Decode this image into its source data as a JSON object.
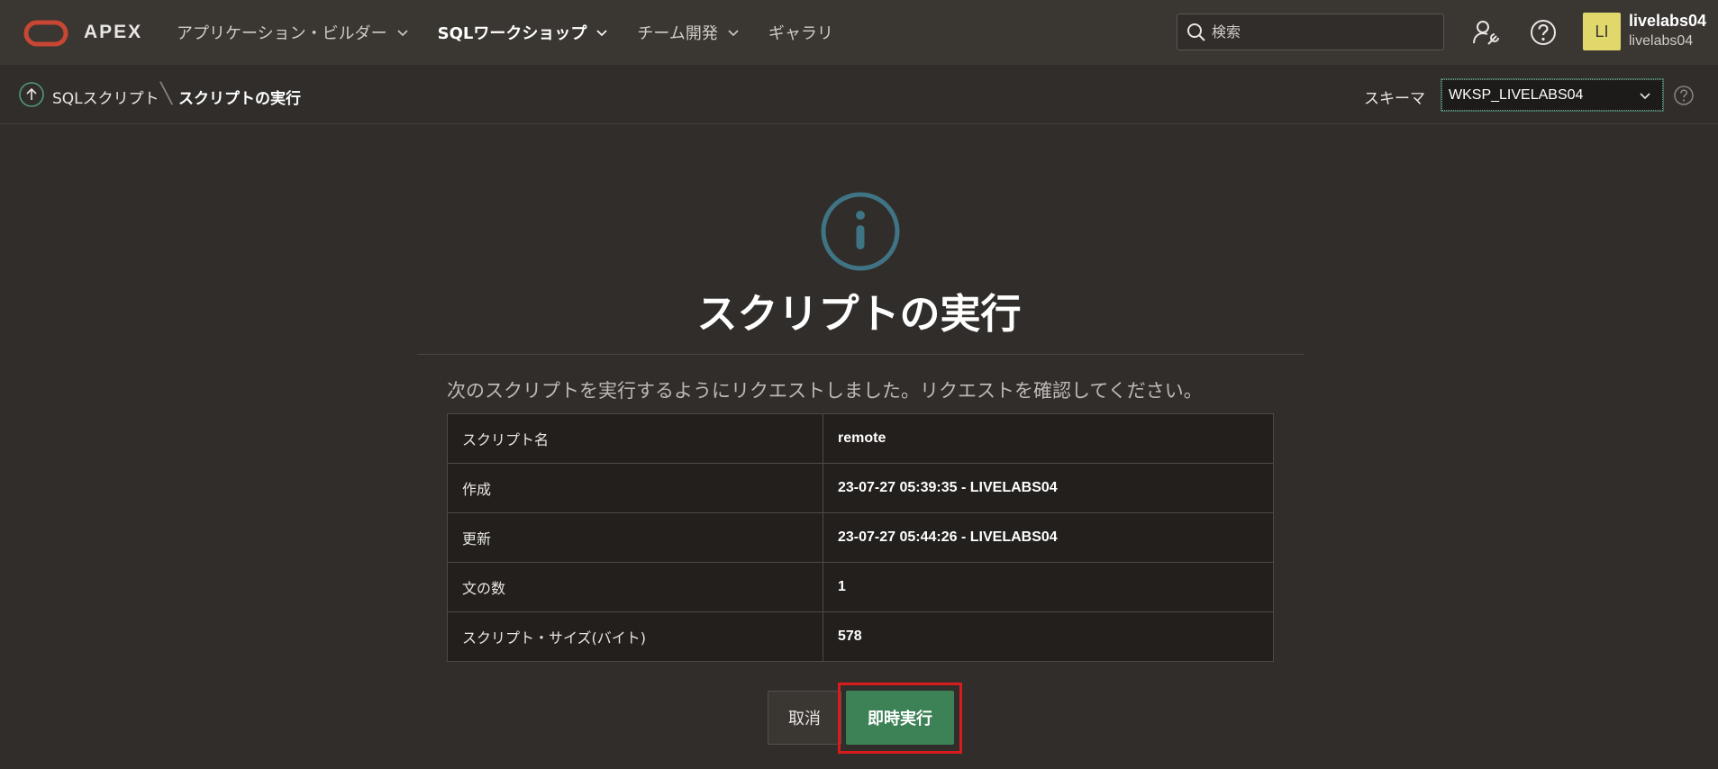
{
  "header": {
    "brand": "APEX",
    "nav": [
      {
        "label": "アプリケーション・ビルダー",
        "active": false
      },
      {
        "label": "SQLワークショップ",
        "active": true
      },
      {
        "label": "チーム開発",
        "active": false
      },
      {
        "label": "ギャラリ",
        "active": false
      }
    ],
    "search_placeholder": "検索",
    "user": {
      "initials": "LI",
      "name": "livelabs04",
      "workspace": "livelabs04"
    }
  },
  "breadcrumb": {
    "parent": "SQLスクリプト",
    "current": "スクリプトの実行"
  },
  "schema": {
    "label": "スキーマ",
    "value": "WKSP_LIVELABS04"
  },
  "main": {
    "title": "スクリプトの実行",
    "message": "次のスクリプトを実行するようにリクエストしました。リクエストを確認してください。",
    "details": [
      {
        "key": "スクリプト名",
        "value": "remote"
      },
      {
        "key": "作成",
        "value": "23-07-27 05:39:35 - LIVELABS04"
      },
      {
        "key": "更新",
        "value": "23-07-27 05:44:26 - LIVELABS04"
      },
      {
        "key": "文の数",
        "value": "1"
      },
      {
        "key": "スクリプト・サイズ(バイト)",
        "value": "578"
      }
    ],
    "cancel_label": "取消",
    "run_label": "即時実行"
  },
  "colors": {
    "accent_green": "#3d8157",
    "highlight_red": "#d81c1c",
    "info_icon": "#3f7484",
    "logo_red": "#c74634"
  }
}
